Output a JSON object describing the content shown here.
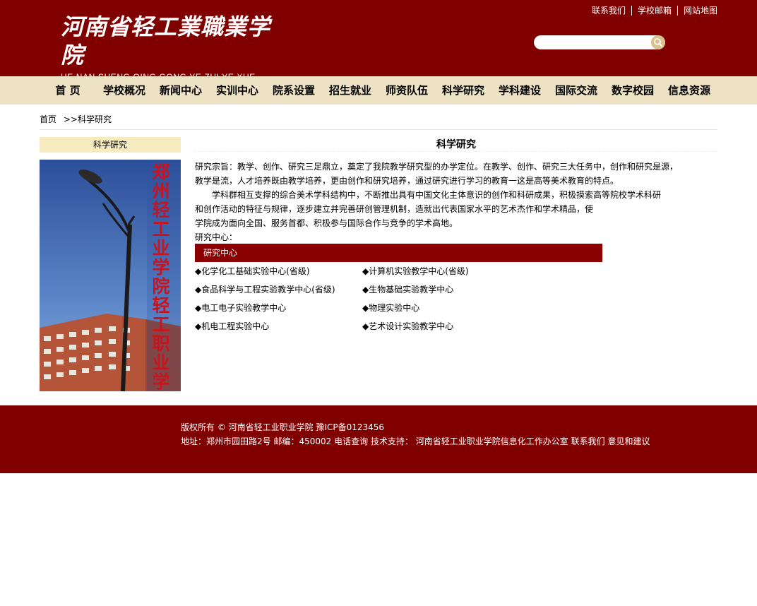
{
  "header": {
    "logo_cn": "河南省轻工業職業学院",
    "logo_pinyin": "HE NAN SHENG QING GONG YE ZHI YE XUE YUAN",
    "top_links": [
      "联系我们",
      "学校邮箱",
      "网站地图"
    ],
    "search": {
      "placeholder": "",
      "button_icon": "search-icon"
    }
  },
  "nav": {
    "items": [
      "首 页",
      "学校概况",
      "新闻中心",
      "实训中心",
      "院系设置",
      "招生就业",
      "师资队伍",
      "科学研究",
      "学科建设",
      "国际交流",
      "数字校园",
      "信息资源"
    ]
  },
  "breadcrumb": {
    "home": "首页",
    "sep": ">>",
    "current": "科学研究"
  },
  "sidebar": {
    "title": "科学研究",
    "photo_text": "郑州轻工业学院轻工职业学院"
  },
  "main": {
    "title": "科学研究",
    "paragraphs": [
      "研究宗旨：教学、创作、研究三足鼎立，奠定了我院教学研究型的办学定位。在教学、创作、研究三大任务中，创作和研究是源，",
      "教学是流，人才培养既由教学培养，更由创作和研究培养，通过研究进行学习的教育一这是高等美术教育的特点。",
      "　　学科群相互支撑的综合美术学科结构中，不断推出具有中国文化主体意识的创作和科研成果，积极摸索高等院校学术科研",
      "和创作活动的特征与规律，逐步建立并完善研创管理机制，造就出代表国家水平的艺术杰作和学术精品，使",
      "学院成为面向全国、服务首都、积极参与国际合作与竞争的学术高地。",
      "研究中心："
    ],
    "center_bar": "研究中心",
    "labs": [
      [
        "◆化学化工基础实验中心(省级)",
        "◆计算机实验教学中心(省级)"
      ],
      [
        "◆食品科学与工程实验教学中心(省级)",
        "◆生物基础实验教学中心"
      ],
      [
        "◆电工电子实验教学中心",
        "◆物理实验中心"
      ],
      [
        "◆机电工程实验中心",
        "◆艺术设计实验教学中心"
      ]
    ]
  },
  "footer": {
    "copyright": "版权所有 © 河南省轻工业职业学院 豫ICP备0123456",
    "address": "地址：郑州市园田路2号 邮编：450002",
    "phone_query": "电话查询",
    "tech_support": "技术支持：",
    "office": "河南省轻工业职业学院信息化工作办公室",
    "contact": "联系我们",
    "feedback": "意见和建议"
  },
  "colors": {
    "brand": "#800000",
    "nav_bg": "#ede2c3",
    "sidebar_title_bg": "#f7ebc0",
    "center_bar": "#8b0000"
  }
}
